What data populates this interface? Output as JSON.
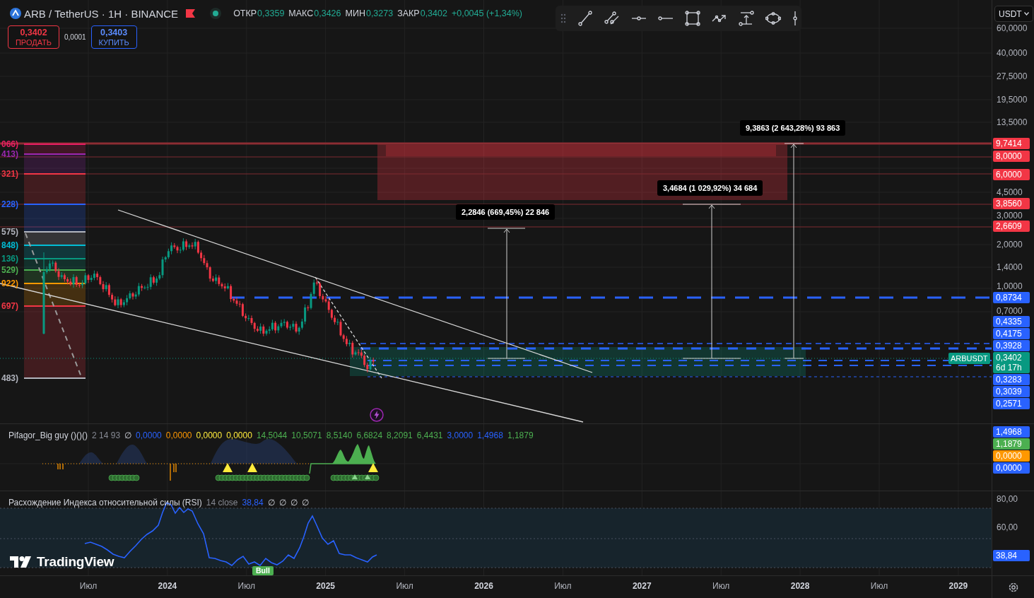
{
  "symbol": "ARB / TetherUS · 1H · BINANCE",
  "ohlc": [
    {
      "label": "ОТКР",
      "value": "0,3359"
    },
    {
      "label": "МАКС",
      "value": "0,3426"
    },
    {
      "label": "МИН",
      "value": "0,3273"
    },
    {
      "label": "ЗАКР",
      "value": "0,3402"
    }
  ],
  "change": "+0,0045 (+1,34%)",
  "trade": {
    "sell": {
      "price": "0,3402",
      "label": "ПРОДАТЬ"
    },
    "spread": "0,0001",
    "buy": {
      "price": "0,3403",
      "label": "КУПИТЬ"
    }
  },
  "currency": "USDT",
  "fib_levels": [
    {
      "label": "066)",
      "color": "#e91e63"
    },
    {
      "label": "413)",
      "color": "#9c27b0"
    },
    {
      "label": "321)",
      "color": "#f23645"
    },
    {
      "label": "228)",
      "color": "#2962ff"
    },
    {
      "label": "575)",
      "color": "#b2b5be"
    },
    {
      "label": "848)",
      "color": "#00bcd4"
    },
    {
      "label": "136)",
      "color": "#089981"
    },
    {
      "label": "529)",
      "color": "#4caf50"
    },
    {
      "label": "922)",
      "color": "#ff9800"
    },
    {
      "label": "697)",
      "color": "#f23645"
    },
    {
      "label": "483)",
      "color": "#b2b5be"
    }
  ],
  "measurements": [
    "9,3863 (2 643,28%) 93 863",
    "3,4684 (1 029,92%) 34 684",
    "2,2846 (669,45%) 22 846"
  ],
  "price_tag": "ARBUSDT",
  "price_axis": {
    "ticks": [
      "60,0000",
      "40,0000",
      "27,5000",
      "19,5000",
      "13,5000",
      "4,5000",
      "3,0000",
      "2,0000",
      "1,4000",
      "1,0000",
      "0,7000"
    ],
    "badges": [
      {
        "value": "9,7414",
        "color": "#f23645"
      },
      {
        "value": "8,0000",
        "color": "#f23645"
      },
      {
        "value": "6,0000",
        "color": "#f23645"
      },
      {
        "value": "3,8560",
        "color": "#f23645"
      },
      {
        "value": "2,6609",
        "color": "#f23645"
      },
      {
        "value": "0,8734",
        "color": "#2962ff"
      },
      {
        "value": "0,4335",
        "color": "#2962ff"
      },
      {
        "value": "0,4175",
        "color": "#2962ff"
      },
      {
        "value": "0,3928",
        "color": "#2962ff"
      },
      {
        "value": "0,3402",
        "countdown": "6d 17h",
        "color": "#089981"
      },
      {
        "value": "0,3283",
        "color": "#2962ff"
      },
      {
        "value": "0,3039",
        "color": "#2962ff"
      },
      {
        "value": "0,2571",
        "color": "#2962ff"
      }
    ]
  },
  "indicator": {
    "name": "Pifagor_Big guy ()()()",
    "params": "2 14 93",
    "na": "∅",
    "values": [
      {
        "text": "0,0000",
        "color": "#2962ff"
      },
      {
        "text": "0,0000",
        "color": "#ff9800"
      },
      {
        "text": "0,0000",
        "color": "#ffeb3b"
      },
      {
        "text": "0,0000",
        "color": "#ffeb3b"
      },
      {
        "text": "14,5044",
        "color": "#4caf50"
      },
      {
        "text": "10,5071",
        "color": "#4caf50"
      },
      {
        "text": "8,5140",
        "color": "#4caf50"
      },
      {
        "text": "6,6824",
        "color": "#4caf50"
      },
      {
        "text": "8,2091",
        "color": "#4caf50"
      },
      {
        "text": "6,4431",
        "color": "#4caf50"
      },
      {
        "text": "3,0000",
        "color": "#2962ff"
      },
      {
        "text": "1,4968",
        "color": "#2962ff"
      },
      {
        "text": "1,1879",
        "color": "#4caf50"
      }
    ],
    "badges": [
      {
        "value": "1,4968",
        "color": "#2962ff"
      },
      {
        "value": "1,1879",
        "color": "#4caf50"
      },
      {
        "value": "0,0000",
        "color": "#ff9800"
      },
      {
        "value": "0,0000",
        "color": "#2962ff"
      }
    ]
  },
  "rsi": {
    "name": "Расхождение Индекса относительной силы (RSI)",
    "params": "14 close",
    "value": "38,84",
    "extras": [
      "∅",
      "∅",
      "∅",
      "∅"
    ],
    "ticks": [
      "80,00",
      "60,00"
    ],
    "badge": "38,84",
    "signal": "Bull"
  },
  "logo": "TradingView",
  "time_axis": [
    {
      "label": "Июл",
      "kind": "month"
    },
    {
      "label": "2024",
      "kind": "year"
    },
    {
      "label": "Июл",
      "kind": "month"
    },
    {
      "label": "2025",
      "kind": "year"
    },
    {
      "label": "Июл",
      "kind": "month"
    },
    {
      "label": "2026",
      "kind": "year"
    },
    {
      "label": "Июл",
      "kind": "month"
    },
    {
      "label": "2027",
      "kind": "year"
    },
    {
      "label": "Июл",
      "kind": "month"
    },
    {
      "label": "2028",
      "kind": "year"
    },
    {
      "label": "Июл",
      "kind": "month"
    },
    {
      "label": "2029",
      "kind": "year"
    }
  ]
}
